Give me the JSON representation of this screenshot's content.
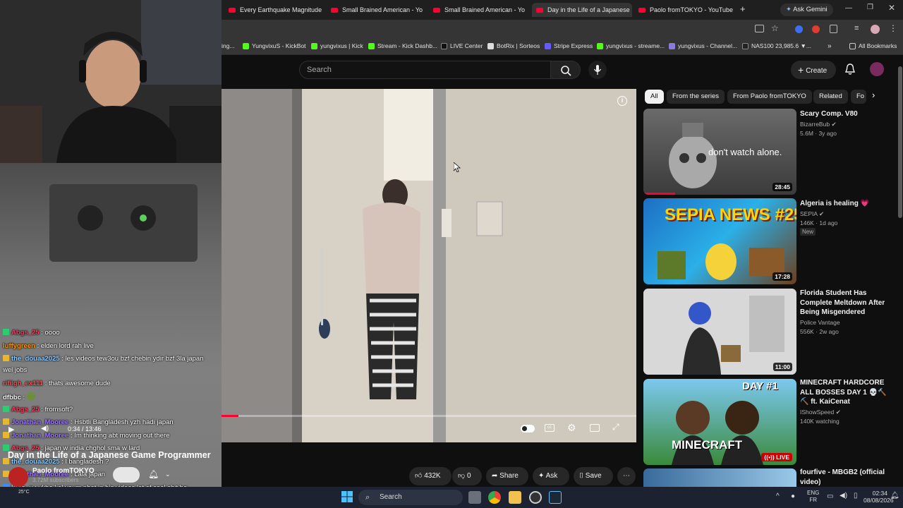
{
  "tabs": [
    {
      "label": "Every Earthquake Magnitude",
      "close": "×"
    },
    {
      "label": "Small Brained American - Yo",
      "close": "×"
    },
    {
      "label": "Small Brained American - Yo",
      "close": "×"
    },
    {
      "label": "Day in the Life of a Japanese",
      "close": "×"
    },
    {
      "label": "Paolo fromTOKYO - YouTube",
      "close": "×"
    }
  ],
  "new_tab": "+",
  "ask_gemini": "Ask Gemini",
  "bookmarks": [
    {
      "label": "ing..."
    },
    {
      "label": "YungvixuS - KickBot"
    },
    {
      "label": "yungvixus | Kick"
    },
    {
      "label": "Stream - Kick Dashb..."
    },
    {
      "label": "LIVE Center"
    },
    {
      "label": "BotRix | Sorteos"
    },
    {
      "label": "Stripe Express"
    },
    {
      "label": "yungvixus - streame..."
    },
    {
      "label": "yungvixus - Channel..."
    },
    {
      "label": "NAS100 23,985.6 ▼..."
    }
  ],
  "all_bookmarks": "All Bookmarks",
  "header": {
    "search_placeholder": "Search",
    "create_label": "Create"
  },
  "chips": [
    "All",
    "From the series",
    "From Paolo fromTOKYO",
    "Related",
    "Fo"
  ],
  "player": {
    "time": "0:34 / 13:46"
  },
  "video": {
    "title": "Day in the Life of a Japanese Game Programmer",
    "channel": "Paolo fromTOKYO",
    "subscribers": "3.72M subscribers",
    "likes": "432K",
    "dislikes": "0",
    "share": "Share",
    "ask": "Ask",
    "save": "Save"
  },
  "recommendations": [
    {
      "title": "Scary Comp. V80",
      "channel": "BizarreBub",
      "meta": "5.6M · 3y ago",
      "duration": "28:45",
      "thumb_text": "don't watch alone.",
      "badge": ""
    },
    {
      "title": "Algeria is healing 💗",
      "channel": "SEPIA",
      "meta": "146K · 1d ago",
      "duration": "17:28",
      "thumb_text": "SEPIA NEWS #25",
      "badge": "New"
    },
    {
      "title": "Florida Student Has Complete Meltdown After Being Misgendered",
      "channel": "Police Vantage",
      "meta": "556K · 2w ago",
      "duration": "11:00",
      "thumb_text": "",
      "badge": ""
    },
    {
      "title": "MINECRAFT HARDCORE ALL BOSSES DAY 1 💀🔨⛏️ ft. KaiCenat",
      "channel": "IShowSpeed",
      "meta": "140K watching",
      "duration": "LIVE",
      "thumb_text": "DAY #1",
      "thumb_text2": "MINECRAFT",
      "badge": ""
    },
    {
      "title": "fourfive - MBGB2 (official video)",
      "channel": "",
      "meta": "",
      "duration": "",
      "thumb_text": "",
      "badge": ""
    }
  ],
  "chat": [
    {
      "user": "Abgs_25",
      "text": ": oooo",
      "color": "#ff3b5c",
      "badge": "#2ecc71"
    },
    {
      "user": "luffygreen",
      "text": ": elden lord rah live",
      "color": "#ff9900",
      "badge": ""
    },
    {
      "user": "the_douaa2025",
      "text": ": les videos tew3ou bzf chebin ydir bzf 3la japan",
      "color": "#8ecbff",
      "badge": "#e8b730"
    },
    {
      "user": "",
      "text": "wel jobs",
      "color": "#ffffff",
      "badge": ""
    },
    {
      "user": "rifiigh_ex111",
      "text": ": thats awesome dude",
      "color": "#ff4d4d",
      "badge": ""
    },
    {
      "user": "dfbbc",
      "text": ":",
      "color": "#ffffff",
      "badge": ""
    },
    {
      "user": "Abgs_25",
      "text": ": fromsoft?",
      "color": "#ff3b5c",
      "badge": "#2ecc71"
    },
    {
      "user": "Jonathan_Mooree",
      "text": ": Hsbtli Bangladesh yzh hadi japan",
      "color": "#a17bff",
      "badge": "#e8b730"
    },
    {
      "user": "Jonathan_Mooree",
      "text": ": Im thinking abt moving out there",
      "color": "#a17bff",
      "badge": "#e8b730"
    },
    {
      "user": "Abgs_25",
      "text": ": japan w india chghol sma w lard",
      "color": "#ff3b5c",
      "badge": "#2ecc71"
    },
    {
      "user": "the_douaa2025",
      "text": ": l bangladesh ?",
      "color": "#8ecbff",
      "badge": "#e8b730"
    },
    {
      "user": "Jonathan_Mooree",
      "text": ": Lala japan",
      "color": "#a17bff",
      "badge": "#e8b730"
    },
    {
      "user": "luho_x",
      "text": ": ykho kol youm nbat in his videos lot of cool shit he",
      "color": "#7cffb2",
      "badge": "#3b8dff"
    },
    {
      "user": "the_douaa2025",
      "text": ":",
      "color": "#8ecbff",
      "badge": "#e8b730"
    }
  ],
  "taskbar": {
    "search": "Search",
    "lang1": "ENG",
    "lang2": "FR",
    "time": "02:34",
    "date": "08/08/2026",
    "weather": "25°C"
  },
  "colors": {
    "accent_red": "#ff0033",
    "bg": "#0f0f0f",
    "chip_bg": "#272727"
  }
}
